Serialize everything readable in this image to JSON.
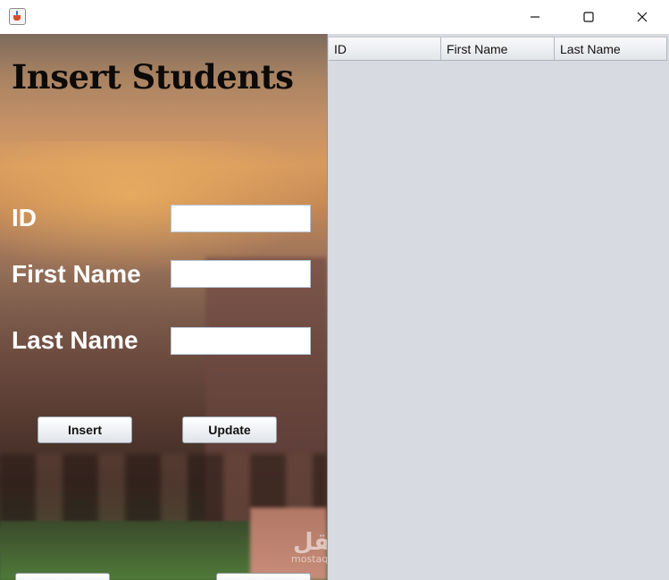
{
  "window": {
    "icon": "java-cup-icon",
    "controls": {
      "minimize": "minimize-icon",
      "maximize": "maximize-icon",
      "close": "close-icon"
    }
  },
  "form": {
    "title": "Insert Students",
    "fields": {
      "id": {
        "label": "ID",
        "value": "",
        "placeholder": ""
      },
      "first_name": {
        "label": "First Name",
        "value": "",
        "placeholder": ""
      },
      "last_name": {
        "label": "Last Name",
        "value": "",
        "placeholder": ""
      }
    },
    "buttons": {
      "insert": "Insert",
      "update": "Update"
    }
  },
  "table": {
    "columns": [
      "ID",
      "First Name",
      "Last Name"
    ],
    "rows": []
  },
  "watermark": {
    "arabic": "مستقل",
    "latin": "mostaql.com"
  },
  "colors": {
    "table_background": "#d8dae1",
    "title_text": "#0d0a08",
    "label_text": "#ffffff"
  }
}
